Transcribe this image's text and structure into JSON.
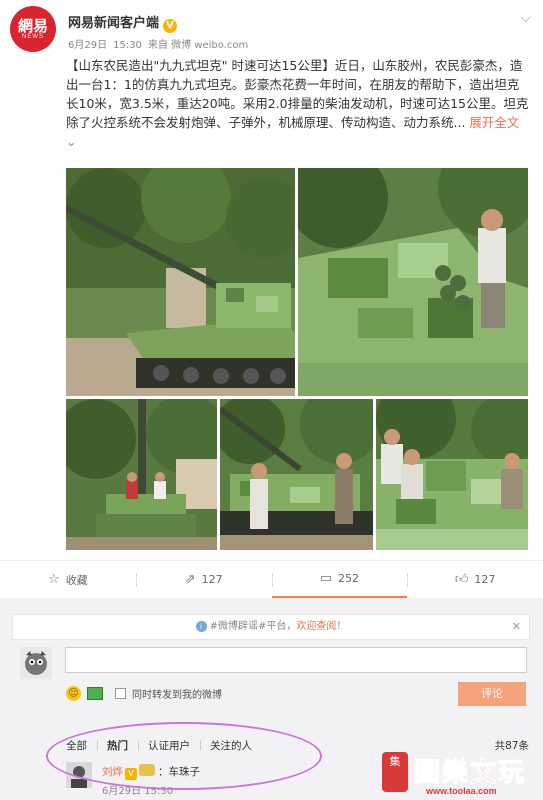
{
  "post": {
    "author": "网易新闻客户端",
    "avatar_logo": "網易",
    "avatar_logo_en": "NEWS",
    "date": "6月29日",
    "time": "15:30",
    "source": "来自 微博 weibo.com",
    "title": "【山东农民造出\"九九式坦克\" 时速可达15公里】",
    "body": "近日，山东胶州，农民彭豪杰，造出一台1：1的仿真九九式坦克。彭豪杰花费一年时间，在朋友的帮助下，造出坦克长10米，宽3.5米，重达20吨。采用2.0排量的柴油发动机，时速可达15公里。坦克除了火控系统不会发射炮弹、子弹外，机械原理、传动构造、动力系统...",
    "expand_label": "展开全文",
    "expand_icon": "chevron-down-icon"
  },
  "actions": {
    "favorite_label": "收藏",
    "repost_count": "127",
    "comment_count": "252",
    "like_count": "127"
  },
  "comment_box": {
    "notice_prefix": "#微博辟谣#平台，",
    "notice_link": "欢迎查阅！",
    "repost_checkbox_label": "同时转发到我的微博",
    "submit_label": "评论"
  },
  "comment_filters": {
    "tabs": [
      "全部",
      "热门",
      "认证用户",
      "关注的人"
    ],
    "total": "共87条"
  },
  "comments": [
    {
      "user": "刘烨",
      "separator": "：",
      "text": "车珠子",
      "time": "6月29日 15:30"
    }
  ],
  "watermark": {
    "stamp": "集",
    "text": "圖樂文玩",
    "url": "www.toolaa.com"
  },
  "colors": {
    "accent": "#eb7350",
    "brand_red": "#d9232d",
    "verified": "#f7b500",
    "ellipse": "#c678d6"
  }
}
